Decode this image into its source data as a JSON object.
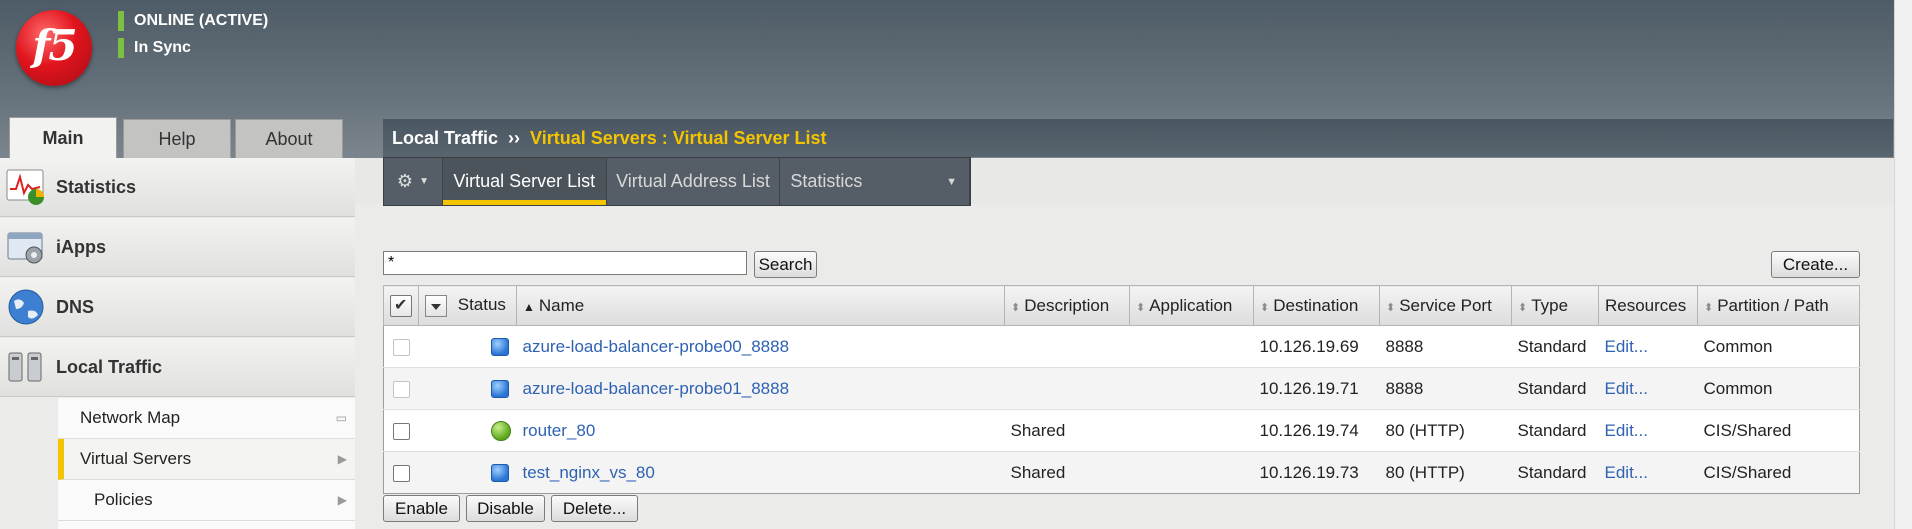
{
  "header": {
    "logo_text": "f5",
    "status_lines": [
      "ONLINE (ACTIVE)",
      "In Sync"
    ],
    "status_color": "#7bc043"
  },
  "tabs": [
    {
      "label": "Main",
      "active": true
    },
    {
      "label": "Help",
      "active": false
    },
    {
      "label": "About",
      "active": false
    }
  ],
  "sidebar": {
    "sections": [
      {
        "label": "Statistics",
        "icon": "statistics-icon"
      },
      {
        "label": "iApps",
        "icon": "iapps-icon"
      },
      {
        "label": "DNS",
        "icon": "dns-globe-icon"
      },
      {
        "label": "Local Traffic",
        "icon": "local-traffic-icon"
      }
    ],
    "sub_items": [
      {
        "label": "Network Map"
      },
      {
        "label": "Virtual Servers",
        "selected": true
      },
      {
        "label": "Policies"
      }
    ]
  },
  "breadcrumb": {
    "section": "Local Traffic",
    "separator": "››",
    "page": "Virtual Servers : Virtual Server List"
  },
  "subnav": {
    "items": [
      "Virtual Server List",
      "Virtual Address List",
      "Statistics"
    ],
    "active": "Virtual Server List"
  },
  "search": {
    "value": "*",
    "button_label": "Search"
  },
  "create_label": "Create...",
  "table": {
    "columns": [
      "Status",
      "Name",
      "Description",
      "Application",
      "Destination",
      "Service Port",
      "Type",
      "Resources",
      "Partition / Path"
    ],
    "rows": [
      {
        "status": "unknown",
        "name": "azure-load-balancer-probe00_8888",
        "description": "",
        "application": "",
        "destination": "10.126.19.69",
        "port": "8888",
        "type": "Standard",
        "resources": "Edit...",
        "partition": "Common",
        "checkbox_disabled": true
      },
      {
        "status": "unknown",
        "name": "azure-load-balancer-probe01_8888",
        "description": "",
        "application": "",
        "destination": "10.126.19.71",
        "port": "8888",
        "type": "Standard",
        "resources": "Edit...",
        "partition": "Common",
        "checkbox_disabled": true
      },
      {
        "status": "available",
        "name": "router_80",
        "description": "Shared",
        "application": "",
        "destination": "10.126.19.74",
        "port": "80 (HTTP)",
        "type": "Standard",
        "resources": "Edit...",
        "partition": "CIS/Shared",
        "checkbox_disabled": false
      },
      {
        "status": "unknown",
        "name": "test_nginx_vs_80",
        "description": "Shared",
        "application": "",
        "destination": "10.126.19.73",
        "port": "80 (HTTP)",
        "type": "Standard",
        "resources": "Edit...",
        "partition": "CIS/Shared",
        "checkbox_disabled": false
      }
    ]
  },
  "actions": [
    "Enable",
    "Disable",
    "Delete..."
  ]
}
